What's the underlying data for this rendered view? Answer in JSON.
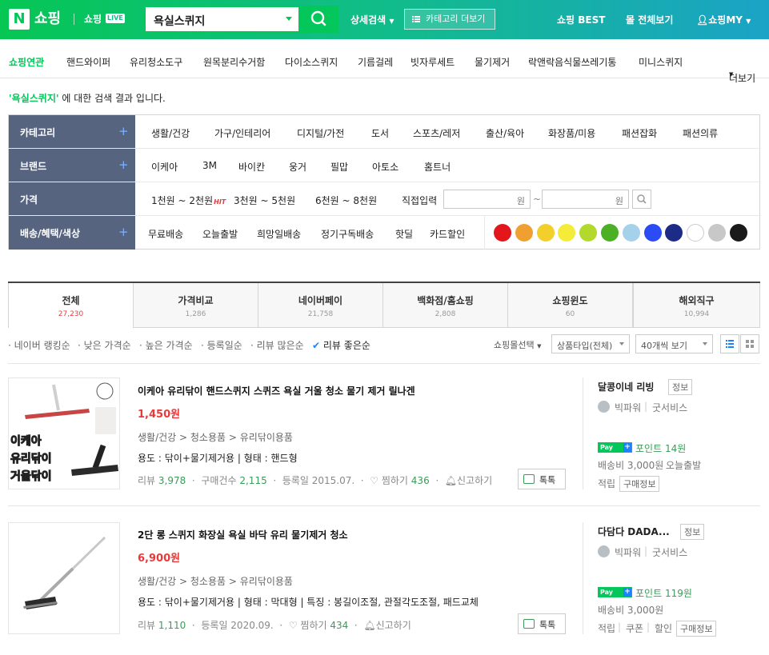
{
  "header": {
    "logo": "N",
    "brand": "쇼핑",
    "live_brand": "쇼핑",
    "live_badge": "LIVE",
    "search_value": "욕실스퀴지",
    "advanced": "상세검색",
    "category_more": "카테고리 더보기",
    "best": "쇼핑 BEST",
    "all_malls": "몰 전체보기",
    "my": "쇼핑MY"
  },
  "related": {
    "label": "쇼핑연관",
    "items": [
      "핸드와이퍼",
      "유리청소도구",
      "원목분리수거함",
      "다이소스퀴지",
      "기름걸레",
      "빗자루세트",
      "물기제거",
      "락앤락음식물쓰레기통",
      "미니스퀴지"
    ],
    "more": "더보기"
  },
  "notice": {
    "keyword": "'욕실스퀴지'",
    "text": " 에 대한 검색 결과 입니다."
  },
  "filters": {
    "category": {
      "label": "카테고리",
      "items": [
        "생활/건강",
        "가구/인테리어",
        "디지털/가전",
        "도서",
        "스포츠/레저",
        "출산/육아",
        "화장품/미용",
        "패션잡화",
        "패션의류"
      ]
    },
    "brand": {
      "label": "브랜드",
      "items": [
        "이케아",
        "3M",
        "바이칸",
        "웅거",
        "필맙",
        "아토소",
        "홈트너"
      ]
    },
    "price": {
      "label": "가격",
      "items": [
        "1천원 ~ 2천원",
        "3천원 ~ 5천원",
        "6천원 ~ 8천원"
      ],
      "hit": "HIT",
      "direct": "직접입력",
      "unit": "원",
      "tilde": "~"
    },
    "delivery": {
      "label": "배송/혜택/색상",
      "items": [
        "무료배송",
        "오늘출발",
        "희망일배송",
        "정기구독배송",
        "핫딜",
        "카드할인"
      ]
    },
    "colors": [
      "#e3161b",
      "#f0a030",
      "#f3cf2c",
      "#f4ec38",
      "#b2d92c",
      "#4bb024",
      "#a6d1ea",
      "#2a4bf5",
      "#1c2c86",
      "#ffffff",
      "#c8c8c8",
      "#1a1a1a"
    ]
  },
  "tabs": [
    {
      "label": "전체",
      "count": "27,230"
    },
    {
      "label": "가격비교",
      "count": "1,286"
    },
    {
      "label": "네이버페이",
      "count": "21,758"
    },
    {
      "label": "백화점/홈쇼핑",
      "count": "2,808"
    },
    {
      "label": "쇼핑윈도",
      "count": "60"
    },
    {
      "label": "해외직구",
      "count": "10,994"
    }
  ],
  "sort": {
    "items": [
      "네이버 랭킹순",
      "낮은 가격순",
      "높은 가격순",
      "등록일순",
      "리뷰 많은순",
      "리뷰 좋은순"
    ],
    "mall_select": "쇼핑몰선택",
    "type_select": "상품타입(전체)",
    "per_page": "40개씩 보기"
  },
  "products": [
    {
      "title": "이케아 유리닦이 핸드스퀴지 스퀴즈 욕실 거울 청소 물기 제거 릴나겐",
      "price": "1,450원",
      "category": "생활/건강 > 청소용품 > 유리닦이용품",
      "spec": "용도 : 닦이+물기제거용  |  형태 : 핸드형",
      "review_label": "리뷰",
      "review": "3,978",
      "purchase_label": "구매건수",
      "purchase": "2,115",
      "date": "등록일 2015.07.",
      "zzim_label": "찜하기",
      "zzim": "436",
      "report": "신고하기",
      "talk": "톡톡",
      "img_text": [
        "이케아",
        "유리닦이",
        "거울닦이"
      ],
      "mall": "달콩이네 리빙",
      "info": "정보",
      "grade": "빅파워",
      "service": "굿서비스",
      "npay": "Pay",
      "point_label": "포인트",
      "point": "14원",
      "shipping": "배송비 3,000원",
      "today": "오늘출발",
      "accrual": "적립",
      "purchase_info": "구매정보"
    },
    {
      "title": "2단 롱 스퀴지 화장실 욕실 바닥 유리 물기제거 청소",
      "price": "6,900원",
      "category": "생활/건강 > 청소용품 > 유리닦이용품",
      "spec": "용도 : 닦이+물기제거용  |  형태 : 막대형  |  특징 : 봉길이조절, 관절각도조절, 패드교체",
      "review_label": "리뷰",
      "review": "1,110",
      "date": "등록일 2020.09.",
      "zzim_label": "찜하기",
      "zzim": "434",
      "report": "신고하기",
      "talk": "톡톡",
      "mall": "다담다 DADA...",
      "info": "정보",
      "grade": "빅파워",
      "service": "굿서비스",
      "npay": "Pay",
      "point_label": "포인트",
      "point": "119원",
      "shipping": "배송비 3,000원",
      "accrual": "적립",
      "coupon": "쿠폰",
      "discount": "할인",
      "purchase_info": "구매정보"
    }
  ]
}
